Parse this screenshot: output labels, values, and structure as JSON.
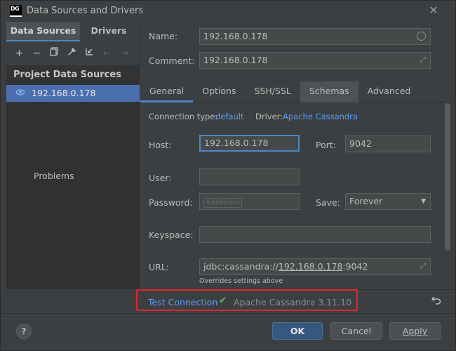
{
  "window": {
    "app_icon_line1": "DG",
    "title": "Data Sources and Drivers",
    "close_glyph": "✕"
  },
  "left": {
    "tabs": [
      {
        "label": "Data Sources",
        "active": true
      },
      {
        "label": "Drivers",
        "active": false
      }
    ],
    "toolbar": [
      {
        "icon": "add-icon",
        "glyph": "+"
      },
      {
        "icon": "remove-icon",
        "glyph": "−"
      },
      {
        "icon": "duplicate-icon",
        "glyph": "⧉"
      },
      {
        "icon": "wrench-icon",
        "glyph": "🔧"
      },
      {
        "icon": "import-icon",
        "glyph": "⤓"
      },
      {
        "icon": "back-arrow-icon",
        "glyph": "←"
      },
      {
        "icon": "forward-arrow-icon",
        "glyph": "→"
      }
    ],
    "tree_header": "Project Data Sources",
    "tree_item": "192.168.0.178",
    "problems_label": "Problems"
  },
  "form": {
    "name_label": "Name:",
    "name_value": "192.168.0.178",
    "comment_label": "Comment:",
    "comment_value": "192.168.0.178",
    "tabs": [
      "General",
      "Options",
      "SSH/SSL",
      "Schemas",
      "Advanced"
    ],
    "connection_type_label": "Connection type:",
    "connection_type_value": "default",
    "driver_label": "Driver:",
    "driver_value": "Apache Cassandra",
    "host_label": "Host:",
    "host_value": "192.168.0.178",
    "port_label": "Port:",
    "port_value": "9042",
    "user_label": "User:",
    "user_value": "",
    "password_label": "Password:",
    "password_placeholder": "<hidden>",
    "save_label": "Save:",
    "save_value": "Forever",
    "keyspace_label": "Keyspace:",
    "keyspace_value": "",
    "url_label": "URL:",
    "url_prefix": "jdbc:cassandra://",
    "url_host": "192.168.0.178",
    "url_suffix": ":9042",
    "url_note": "Overrides settings above"
  },
  "status": {
    "test_connection": "Test Connection",
    "result": "Apache Cassandra 3.11.10"
  },
  "buttons": {
    "help": "?",
    "ok": "OK",
    "cancel": "Cancel",
    "apply": "Apply"
  },
  "colors": {
    "accent": "#4a88c7",
    "link": "#589df6",
    "selection": "#4b6eaf",
    "success": "#5fb15f",
    "highlight_box": "#e0262a"
  }
}
